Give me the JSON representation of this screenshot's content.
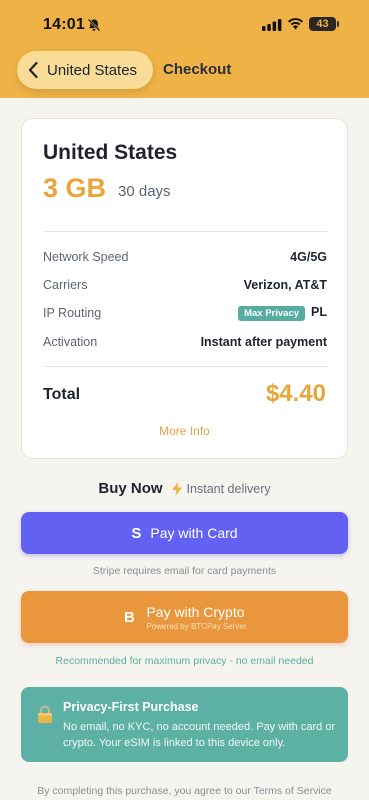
{
  "status_bar": {
    "time": "14:01",
    "battery": "43"
  },
  "nav": {
    "back_label": "United States",
    "title": "Checkout"
  },
  "plan": {
    "country": "United States",
    "data": "3 GB",
    "duration": "30 days",
    "details": [
      {
        "key": "Network Speed",
        "value": "4G/5G"
      },
      {
        "key": "Carriers",
        "value": "Verizon, AT&T"
      },
      {
        "key": "IP Routing",
        "badge": "Max Privacy",
        "value": "PL"
      },
      {
        "key": "Activation",
        "value": "Instant after payment"
      }
    ],
    "total_label": "Total",
    "total_value": "$4.40",
    "more_info": "More Info"
  },
  "buy": {
    "title": "Buy Now",
    "subtitle": "Instant delivery"
  },
  "pay_card": {
    "icon": "S",
    "label": "Pay with Card",
    "note": "Stripe requires email for card payments"
  },
  "pay_crypto": {
    "icon": "B",
    "label": "Pay with Crypto",
    "sub": "Powered by BTCPay Server",
    "note": "Recommended for maximum privacy - no email needed"
  },
  "privacy": {
    "title": "Privacy-First Purchase",
    "body": "No email, no KYC, no account needed. Pay with card or crypto. Your eSIM is linked to this device only."
  },
  "terms": "By completing this purchase, you agree to our Terms of Service",
  "colors": {
    "accent": "#efb246",
    "price": "#e9a53a",
    "card_button": "#6361f1",
    "crypto_button": "#e9963d",
    "privacy_box": "#5db0a4"
  }
}
